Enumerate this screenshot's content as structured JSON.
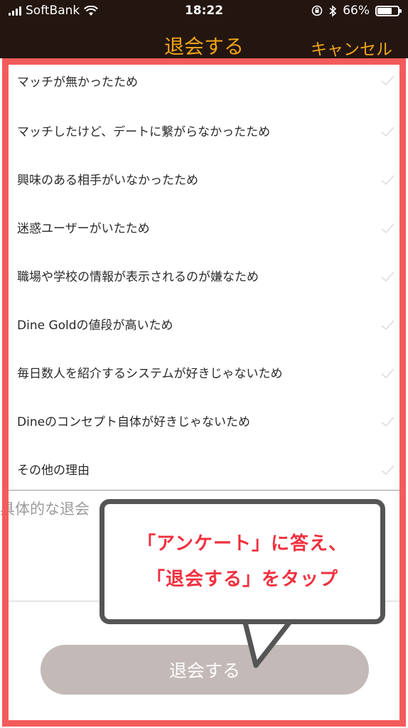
{
  "status_bar": {
    "carrier": "SoftBank",
    "time": "18:22",
    "battery": "66%",
    "battery_level": 0.66
  },
  "header": {
    "title": "退会する",
    "cancel_label": "キャンセル"
  },
  "reasons": [
    {
      "label": "マッチが無かったため"
    },
    {
      "label": "マッチしたけど、デートに繋がらなかったため"
    },
    {
      "label": "興味のある相手がいなかったため"
    },
    {
      "label": "迷惑ユーザーがいたため"
    },
    {
      "label": "職場や学校の情報が表示されるのが嫌なため"
    },
    {
      "label": "Dine Goldの値段が高いため"
    },
    {
      "label": "毎日数人を紹介するシステムが好きじゃないため"
    },
    {
      "label": "Dineのコンセプト自体が好きじゃないため"
    },
    {
      "label": "その他の理由"
    }
  ],
  "reason_input": {
    "placeholder": "具体的な退会"
  },
  "submit_label": "退会する",
  "annotation": {
    "line1": "「アンケート」に答え、",
    "line2": "「退会する」をタップ"
  },
  "colors": {
    "header_bg": "#231510",
    "accent": "#f0a418",
    "highlight_frame": "#f45b5b",
    "submit_disabled": "#c3b9b6",
    "annotation_text": "#f0303f"
  }
}
